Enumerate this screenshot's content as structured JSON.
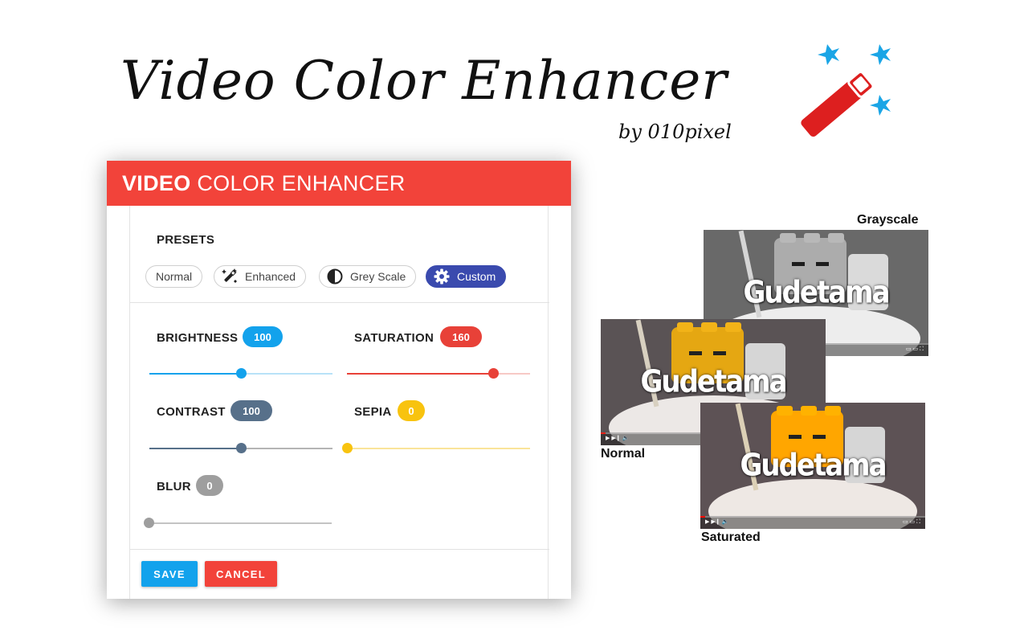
{
  "banner": {
    "title": "Video Color Enhancer",
    "subtitle": "by 010pixel",
    "logo_icon": "magic-wand-icon",
    "colors": {
      "wand": "#dd1f1f",
      "sparkles": "#1aa5e6"
    }
  },
  "panel": {
    "header_bold": "VIDEO",
    "header_rest": "COLOR ENHANCER",
    "header_color": "#f2433a",
    "presets": {
      "title": "PRESETS",
      "items": [
        {
          "label": "Normal",
          "icon": "",
          "active": false
        },
        {
          "label": "Enhanced",
          "icon": "magic-wand-icon",
          "active": false
        },
        {
          "label": "Grey Scale",
          "icon": "contrast-icon",
          "active": false
        },
        {
          "label": "Custom",
          "icon": "gear-icon",
          "active": true
        }
      ]
    },
    "controls": {
      "brightness": {
        "label": "BRIGHTNESS",
        "value": "100",
        "position": 0.5,
        "color": "#13a2ec",
        "track": "#b8e2f8"
      },
      "saturation": {
        "label": "SATURATION",
        "value": "160",
        "position": 0.8,
        "color": "#e84138",
        "track": "#f7c9c6"
      },
      "contrast": {
        "label": "CONTRAST",
        "value": "100",
        "position": 0.5,
        "color": "#57708a",
        "track": "#b5b5b5"
      },
      "sepia": {
        "label": "SEPIA",
        "value": "0",
        "position": 0.0,
        "color": "#f8c30f",
        "track": "#fae49a"
      },
      "blur": {
        "label": "BLUR",
        "value": "0",
        "position": 0.0,
        "color": "#9e9e9e",
        "track": "#c3c3c3"
      }
    },
    "buttons": {
      "save": {
        "label": "SAVE",
        "color": "#13a2ec"
      },
      "cancel": {
        "label": "CANCEL",
        "color": "#f2433a"
      }
    }
  },
  "previews": [
    {
      "caption": "Grayscale",
      "overlay_text": "Gudetama",
      "filter": "grayscale"
    },
    {
      "caption": "Normal",
      "overlay_text": "Gudetama",
      "filter": "normal"
    },
    {
      "caption": "Saturated",
      "overlay_text": "Gudetama",
      "filter": "saturated"
    }
  ]
}
